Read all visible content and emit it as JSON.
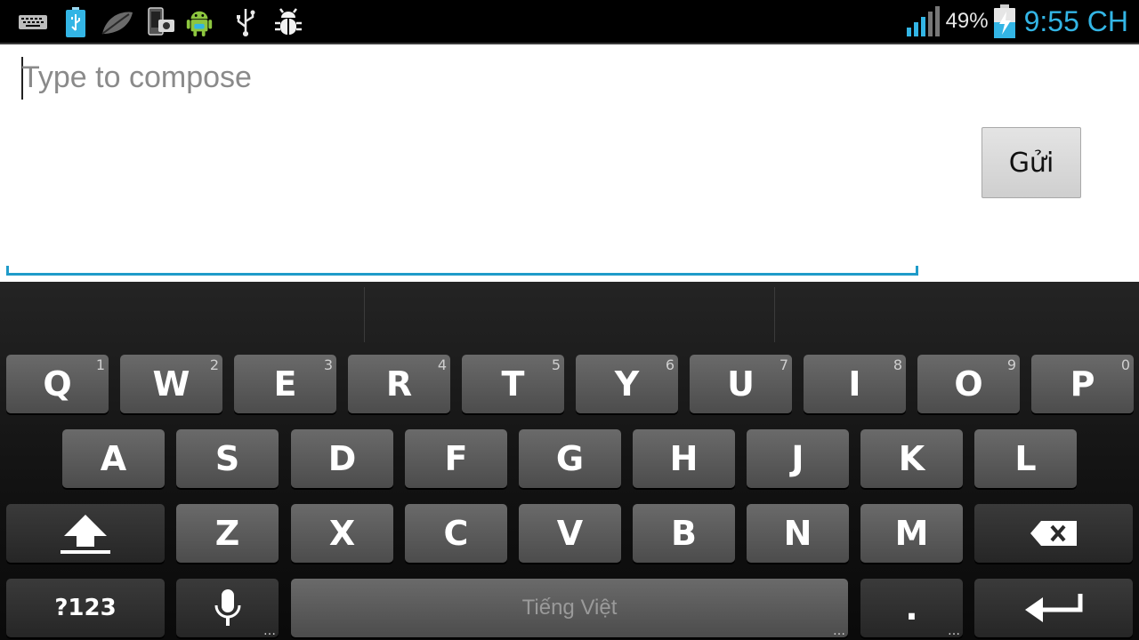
{
  "status_bar": {
    "left_icons": [
      "keyboard-icon",
      "usb-battery-icon",
      "leaf-icon",
      "phone-camera-icon",
      "android-icon",
      "usb-icon",
      "debug-bug-icon"
    ],
    "battery_percent": "49%",
    "time": "9:55 CH",
    "accent_color": "#33b5e5"
  },
  "compose": {
    "placeholder": "Type to compose",
    "send_label": "Gửi",
    "underline_color": "#1f9bc9"
  },
  "keyboard": {
    "row1": [
      {
        "label": "Q",
        "hint": "1"
      },
      {
        "label": "W",
        "hint": "2"
      },
      {
        "label": "E",
        "hint": "3"
      },
      {
        "label": "R",
        "hint": "4"
      },
      {
        "label": "T",
        "hint": "5"
      },
      {
        "label": "Y",
        "hint": "6"
      },
      {
        "label": "U",
        "hint": "7"
      },
      {
        "label": "I",
        "hint": "8"
      },
      {
        "label": "O",
        "hint": "9"
      },
      {
        "label": "P",
        "hint": "0"
      }
    ],
    "row2": [
      "A",
      "S",
      "D",
      "F",
      "G",
      "H",
      "J",
      "K",
      "L"
    ],
    "row3": [
      "Z",
      "X",
      "C",
      "V",
      "B",
      "N",
      "M"
    ],
    "symbols_label": "?123",
    "space_label": "Tiếng Việt",
    "period_label": ".",
    "more_dots": "…",
    "shift_icon": "shift-arrow-icon",
    "backspace_icon": "backspace-icon",
    "mic_icon": "microphone-icon",
    "enter_icon": "enter-arrow-icon"
  }
}
